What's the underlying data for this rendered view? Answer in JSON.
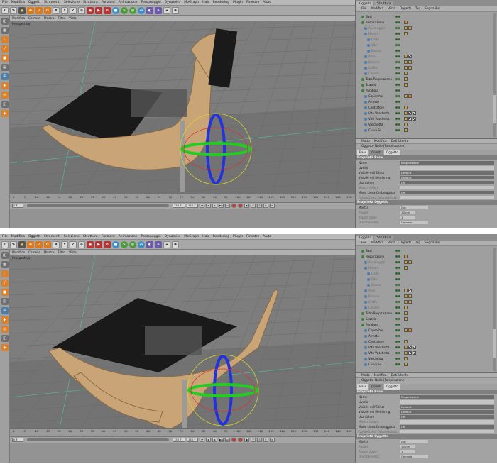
{
  "menu": [
    "File",
    "Modifica",
    "Oggetti",
    "Strumenti",
    "Selezione",
    "Struttura",
    "Funzioni",
    "Animazione",
    "Personaggio",
    "Dynamics",
    "MoGraph",
    "Hair",
    "Rendering",
    "Plugin",
    "Finestre",
    "Aiuto"
  ],
  "toolbar": {
    "icons": [
      "undo-icon",
      "redo-icon",
      "live-selection-icon",
      "move-icon",
      "scale-icon",
      "rotate-icon",
      "x-axis-icon",
      "y-axis-icon",
      "z-axis-icon",
      "coordinate-icon",
      "render-region-icon",
      "render-view-icon",
      "render-settings-icon",
      "cube-primitive-icon",
      "spline-pen-icon",
      "nurbs-icon",
      "array-icon",
      "deformer-icon",
      "scene-icon",
      "camera-icon",
      "light-icon"
    ],
    "axis_x": "X",
    "axis_y": "Y",
    "axis_z": "Z"
  },
  "view_menu": [
    "Modifica",
    "Camera",
    "Mostra",
    "Filtro",
    "Vista"
  ],
  "viewport": {
    "label": "Prospettiva",
    "colors": {
      "wood": "#c9a477",
      "wood_edge": "#8a6a44",
      "panel": "#1a1a1a",
      "gizmo_x": "#e03030",
      "gizmo_y": "#22cc22",
      "gizmo_z": "#2233dd",
      "gizmo_ring": "#d8d828"
    }
  },
  "timeline": {
    "ticks": [
      "0",
      "5",
      "10",
      "15",
      "20",
      "25",
      "30",
      "35",
      "40",
      "45",
      "50",
      "55",
      "60",
      "65",
      "70",
      "75",
      "80",
      "85",
      "90",
      "95",
      "100",
      "105",
      "110",
      "115",
      "120",
      "125",
      "130",
      "135",
      "140",
      "145",
      "150"
    ],
    "frame_start": "0 F",
    "frame_end": "150 F",
    "current_end": "150 F"
  },
  "panel_tabs": {
    "objects": "Oggetti",
    "structure": "Struttura"
  },
  "obj_menu": [
    "File",
    "Modifica",
    "Vista",
    "Oggetti",
    "Tag",
    "Segnalibri"
  ],
  "objects": [
    {
      "name": "Basi",
      "level": 2,
      "dim": false,
      "tags": []
    },
    {
      "name": "Respirazione",
      "level": 2,
      "dim": false,
      "tags": [
        "or"
      ]
    },
    {
      "name": "Ancoraggio",
      "level": 3,
      "dim": true,
      "tags": [
        "w",
        "w"
      ]
    },
    {
      "name": "Motore",
      "level": 3,
      "dim": true,
      "tags": [
        "w"
      ]
    },
    {
      "name": "Dado",
      "level": 4,
      "dim": true,
      "tags": []
    },
    {
      "name": "Vite",
      "level": 4,
      "dim": true,
      "tags": []
    },
    {
      "name": "Blocco",
      "level": 4,
      "dim": true,
      "tags": []
    },
    {
      "name": "Asse",
      "level": 3,
      "dim": true,
      "tags": [
        "w",
        "ck"
      ]
    },
    {
      "name": "Braccio",
      "level": 3,
      "dim": true,
      "tags": [
        "w",
        "w"
      ]
    },
    {
      "name": "Staffa",
      "level": 3,
      "dim": true,
      "tags": [
        "w",
        "w"
      ]
    },
    {
      "name": "Cilindro",
      "level": 3,
      "dim": true,
      "tags": [
        "w"
      ]
    },
    {
      "name": "Tubo Respirazione",
      "level": 2,
      "dim": false,
      "tags": [
        "w"
      ]
    },
    {
      "name": "Scatola",
      "level": 2,
      "dim": false,
      "tags": [
        "w"
      ]
    },
    {
      "name": "Parabola",
      "level": 2,
      "dim": false,
      "tags": []
    },
    {
      "name": "Coperchio",
      "level": 3,
      "dim": false,
      "tags": [
        "w",
        "or"
      ]
    },
    {
      "name": "Arresto",
      "level": 3,
      "dim": false,
      "tags": []
    },
    {
      "name": "Centratore",
      "level": 3,
      "dim": false,
      "tags": [
        "w"
      ]
    },
    {
      "name": "Vite Vaschetta",
      "level": 3,
      "dim": false,
      "tags": [
        "w",
        "ck",
        "ck"
      ]
    },
    {
      "name": "Vite Vaschetta",
      "level": 3,
      "dim": false,
      "tags": [
        "w",
        "ck",
        "ck"
      ]
    },
    {
      "name": "Vaschetta",
      "level": 3,
      "dim": false,
      "tags": [
        "w"
      ]
    },
    {
      "name": "Curva Sx",
      "level": 3,
      "dim": false,
      "tags": [
        "w"
      ]
    }
  ],
  "attr": {
    "menu": [
      "Modo",
      "Modifica",
      "Dati Utente"
    ],
    "title": "Oggetto Nullo [Respirazione]",
    "tabs": [
      "Base",
      "Coord.",
      "Oggetto"
    ],
    "base_header": "Proprietà Base",
    "base_rows": [
      {
        "label": "Nome",
        "value": "Respirazione",
        "dim": false,
        "light": false
      },
      {
        "label": "Livello",
        "value": "",
        "dim": false,
        "light": true
      },
      {
        "label": "Visibile nell'Editor",
        "value": "Default",
        "dim": false,
        "light": false
      },
      {
        "label": "Visibile nel Rendering",
        "value": "Default",
        "dim": false,
        "light": false
      },
      {
        "label": "Usa Colore",
        "value": "Off",
        "dim": false,
        "light": false
      },
      {
        "label": "Mostra Colore",
        "value": "",
        "dim": true,
        "light": true
      },
      {
        "label": "Modo Linea Ombreggiata",
        "value": "Off",
        "dim": false,
        "light": false
      },
      {
        "label": "Colore Linea Ombreggiata",
        "value": "",
        "dim": true,
        "light": true
      }
    ],
    "object_header": "Proprietà Oggetto",
    "object_rows": [
      {
        "label": "Mostra",
        "value": "Dot",
        "dim": false,
        "short": true
      },
      {
        "label": "Raggio",
        "value": "10 cm",
        "dim": true,
        "short": false
      },
      {
        "label": "Aspect Ratio",
        "value": "1",
        "dim": true,
        "short": false
      },
      {
        "label": "Orientamento",
        "value": "Camera",
        "dim": true,
        "short": true
      }
    ]
  }
}
